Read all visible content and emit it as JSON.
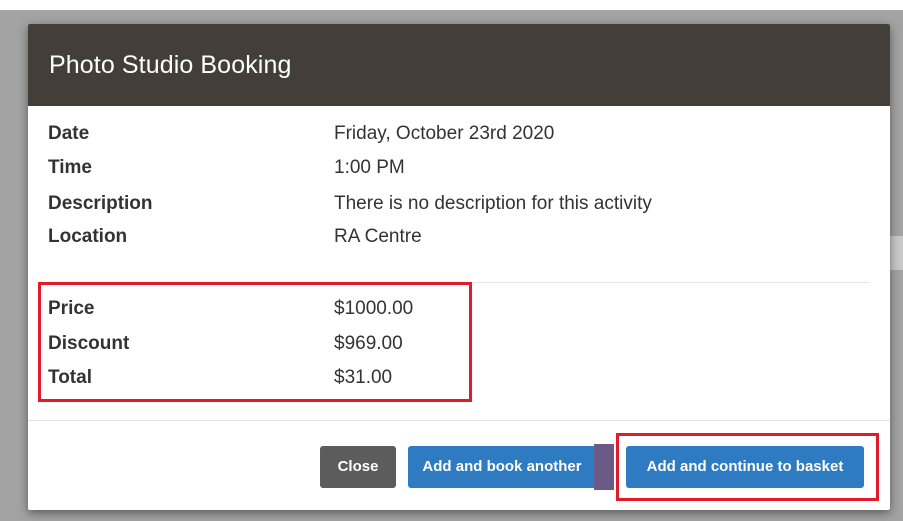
{
  "modal": {
    "title": "Photo Studio Booking",
    "details": [
      {
        "label": "Date",
        "value": "Friday, October 23rd 2020"
      },
      {
        "label": "Time",
        "value": "1:00 PM"
      },
      {
        "label": "Description",
        "value": "There is no description for this activity"
      },
      {
        "label": "Location",
        "value": "RA Centre"
      }
    ],
    "pricing": [
      {
        "label": "Price",
        "value": "$1000.00"
      },
      {
        "label": "Discount",
        "value": "$969.00"
      },
      {
        "label": "Total",
        "value": "$31.00"
      }
    ],
    "buttons": {
      "close": "Close",
      "book_another": "Add and book another",
      "continue_basket": "Add and continue to basket"
    }
  },
  "colors": {
    "header": "#433e38",
    "primary_button": "#2f7bc1",
    "close_button": "#5c5c5c",
    "highlight": "#e01b2b"
  }
}
